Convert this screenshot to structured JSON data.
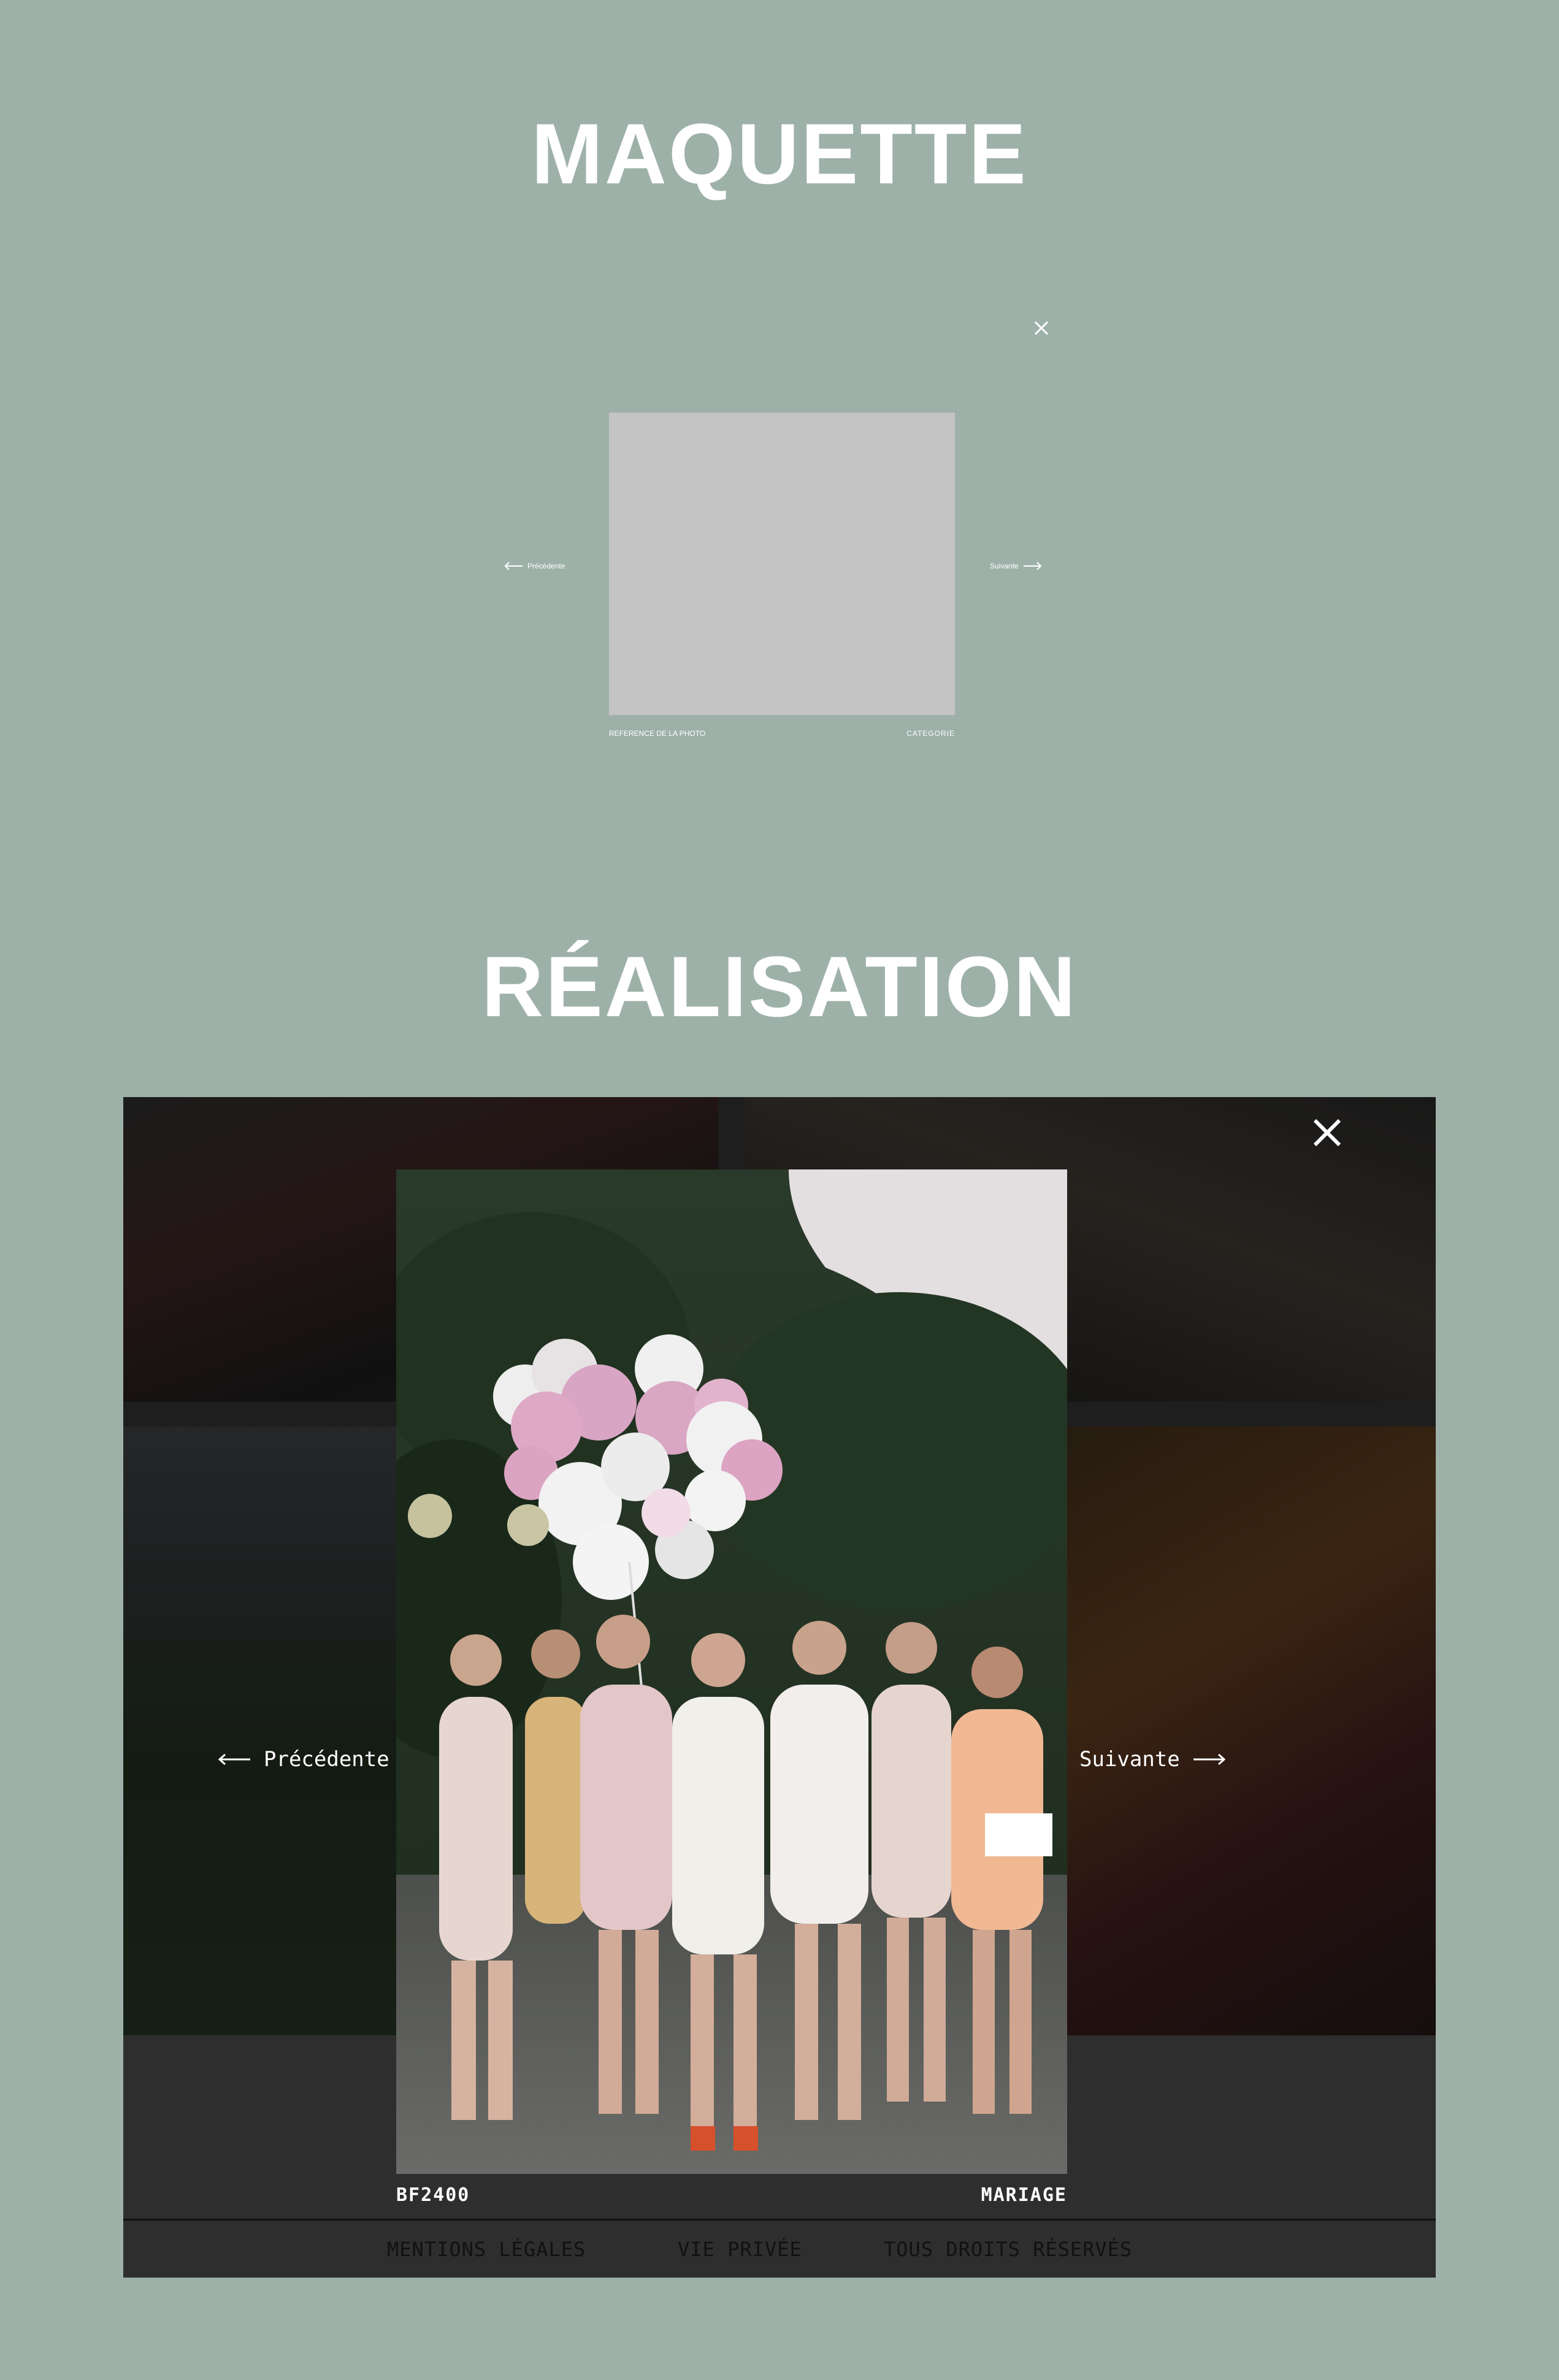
{
  "maquette": {
    "title": "MAQUETTE",
    "close_icon": "close-icon",
    "prev_label": "Précédente",
    "next_label": "Suivante",
    "reference": "REFERENCE DE LA PHOTO",
    "category": "CATEGORIE",
    "placeholder_color": "#c4c4c4"
  },
  "realisation": {
    "title": "RÉALISATION",
    "close_icon": "close-icon",
    "prev_label": "Précédente",
    "next_label": "Suivante",
    "reference": "BF2400",
    "category": "MARIAGE",
    "footer": {
      "links": [
        "MENTIONS LÉGALES",
        "VIE PRIVÉE",
        "TOUS DROITS RÉSERVÉS"
      ]
    }
  },
  "colors": {
    "page_background": "#9eb1a9",
    "lightbox_background": "#2e2e2e",
    "text": "#ffffff",
    "footer_text": "#111111"
  }
}
